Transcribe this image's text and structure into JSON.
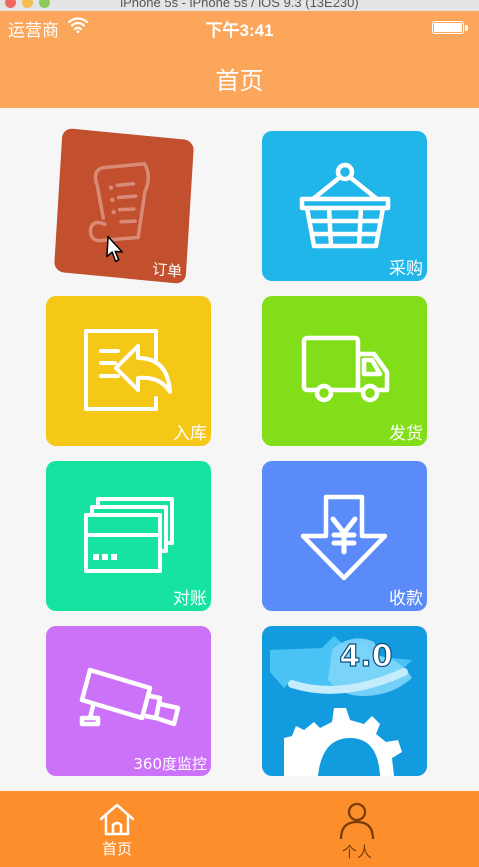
{
  "simulator": {
    "title": "iPhone 5s - iPhone 5s / iOS 9.3 (13E230)"
  },
  "status_bar": {
    "carrier": "运营商",
    "time": "下午3:41",
    "battery_level": 1.0
  },
  "nav": {
    "title": "首页"
  },
  "tiles": [
    {
      "label": "订单",
      "color": "#c24f2e",
      "icon": "order-document-icon"
    },
    {
      "label": "采购",
      "color": "#21b6ea",
      "icon": "shopping-basket-icon"
    },
    {
      "label": "入库",
      "color": "#f5c717",
      "icon": "stock-in-return-icon"
    },
    {
      "label": "发货",
      "color": "#83de1a",
      "icon": "delivery-truck-icon"
    },
    {
      "label": "对账",
      "color": "#16e3a2",
      "icon": "cards-reconcile-icon"
    },
    {
      "label": "收款",
      "color": "#5b8bf9",
      "icon": "yuan-down-arrow-icon"
    },
    {
      "label": "360度监控",
      "color": "#cc72f8",
      "icon": "surveillance-camera-icon"
    },
    {
      "label": "4.0",
      "color": "#129bde",
      "icon": "gear-4-0-icon"
    }
  ],
  "tab_bar": {
    "items": [
      {
        "label": "首页",
        "icon": "home-icon",
        "selected": true
      },
      {
        "label": "个人",
        "icon": "person-icon",
        "selected": false
      }
    ]
  },
  "colors": {
    "nav_bg": "#fba65a",
    "tab_bg": "#fc8f2c",
    "tab_selected": "#ffffff",
    "tab_unselected": "#7a3d05",
    "content_bg": "#f6f6f6"
  }
}
